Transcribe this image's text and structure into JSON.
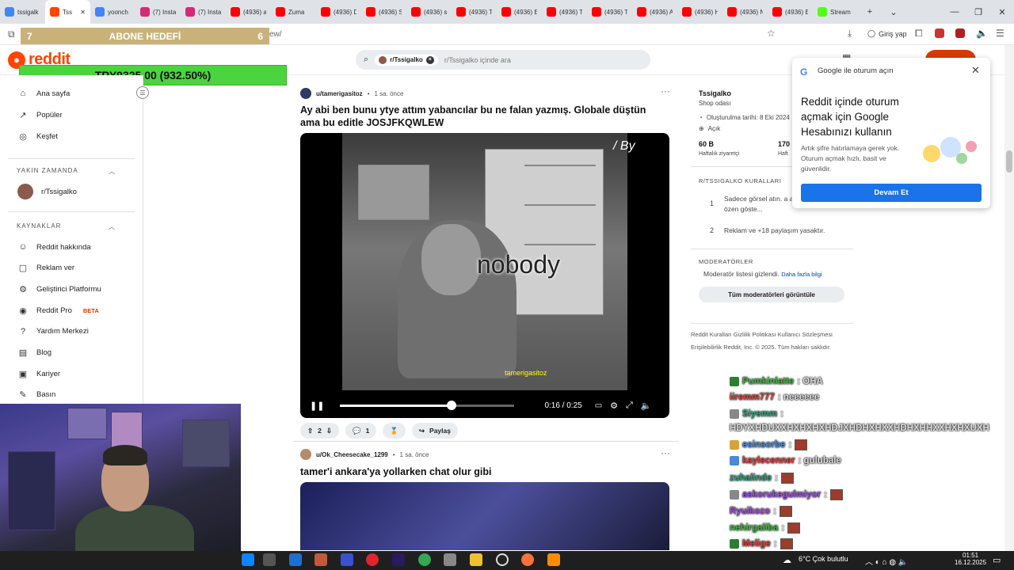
{
  "browser": {
    "tabs": [
      {
        "label": "tssigalk",
        "color": "#4285f4"
      },
      {
        "label": "Tss",
        "color": "#ff4500",
        "active": true
      },
      {
        "label": "yoonch",
        "color": "#4285f4"
      },
      {
        "label": "(7) Insta",
        "color": "#d62976"
      },
      {
        "label": "(7) Insta",
        "color": "#d62976"
      },
      {
        "label": "(4936) a",
        "color": "#ff0000"
      },
      {
        "label": "Zuma",
        "color": "#ff0000"
      },
      {
        "label": "(4936) D",
        "color": "#ff0000"
      },
      {
        "label": "(4936) S",
        "color": "#ff0000"
      },
      {
        "label": "(4936) s",
        "color": "#ff0000"
      },
      {
        "label": "(4936) T",
        "color": "#ff0000"
      },
      {
        "label": "(4936) E",
        "color": "#ff0000"
      },
      {
        "label": "(4936) T",
        "color": "#ff0000"
      },
      {
        "label": "(4936) T",
        "color": "#ff0000"
      },
      {
        "label": "(4936) A",
        "color": "#ff0000"
      },
      {
        "label": "(4936) H",
        "color": "#ff0000"
      },
      {
        "label": "(4936) N",
        "color": "#ff0000"
      },
      {
        "label": "(4936) E",
        "color": "#ff0000"
      },
      {
        "label": "Stream",
        "color": "#53fc18"
      }
    ],
    "url_fragment": "ew/",
    "login_label": "Giriş yap"
  },
  "overlay": {
    "abone_left": "7",
    "abone_label": "ABONE HEDEFİ",
    "abone_right": "6",
    "donation": "TRY9325.00 (932.50%)"
  },
  "reddit": {
    "logo": "reddit",
    "search_chip": "r/Tssigalko",
    "search_placeholder": "r/Tssigalko içinde ara"
  },
  "sidebar": {
    "nav": [
      {
        "label": "Ana sayfa",
        "icon": "⌂"
      },
      {
        "label": "Popüler",
        "icon": "↗"
      },
      {
        "label": "Keşfet",
        "icon": "◎"
      }
    ],
    "recent_header": "YAKIN ZAMANDA",
    "recent": [
      {
        "label": "r/Tssigalko"
      }
    ],
    "resources_header": "KAYNAKLAR",
    "resources": [
      {
        "label": "Reddit hakkında",
        "icon": "☺"
      },
      {
        "label": "Reklam ver",
        "icon": "▢"
      },
      {
        "label": "Geliştirici Platformu",
        "icon": "⚙"
      },
      {
        "label": "Reddit Pro",
        "icon": "◉",
        "badge": "BETA"
      },
      {
        "label": "Yardım Merkezi",
        "icon": "?"
      },
      {
        "label": "Blog",
        "icon": "▤"
      },
      {
        "label": "Kariyer",
        "icon": "▣"
      },
      {
        "label": "Basın",
        "icon": "✎"
      }
    ]
  },
  "post1": {
    "author": "u/tamerigasitoz",
    "time": "1 sa. önce",
    "title": "Ay abi ben bunu ytye attım yabancılar bu ne falan yazmış. Globale düştün ama bu editle JOSJFKQWLEW",
    "video_caption": "nobody",
    "video_watermark": "tamerigasitoz",
    "video_corner": "/ By",
    "time_display": "0:16 / 0:25",
    "progress": 0.64,
    "votes": "2",
    "comments": "1",
    "share": "Paylaş"
  },
  "post2": {
    "author": "u/Ok_Cheesecake_1299",
    "time": "1 sa. önce",
    "title": "tamer'i ankara'ya yollarken chat olur gibi"
  },
  "right": {
    "sub_name": "Tssigalko",
    "sub_desc": "Shop odası",
    "created": "Oluşturulma tarihi: 8 Eki 2024",
    "open": "Açık",
    "stat1_value": "60 B",
    "stat1_label": "Haftalık ziyaretçi",
    "stat2_value": "170",
    "stat2_label": "Haft",
    "rules_header": "R/TSSIGALKO KURALLARI",
    "rules": [
      {
        "num": "1",
        "text": "Sadece görsel atın. a atmamaya özen göste..."
      },
      {
        "num": "2",
        "text": "Reklam ve +18 paylaşım yasaktır."
      }
    ],
    "mods_header": "MODERATÖRLER",
    "mods_text": "Moderatör listesi gizlendi.",
    "mods_link": "Daha fazla bilgi",
    "mods_button": "Tüm moderatörleri görüntüle",
    "footer_line1": "Reddit Kuralları   Gizlilik Politikası   Kullanıcı Sözleşmesi",
    "footer_line2": "Erişilebilirlik   Reddit, Inc. © 2025. Tüm hakları saklıdır."
  },
  "google_popup": {
    "title": "Google ile oturum açın",
    "heading": "Reddit içinde oturum açmak için Google Hesabınızı kullanın",
    "body": "Artık şifre hatırlamaya gerek yok. Oturum açmak hızlı, basit ve güvenlidir.",
    "button": "Devam Et"
  },
  "chat": [
    {
      "user": "Pumkinlatte",
      "color": "#3ab53a",
      "msg": ": OHA",
      "badge": "#2e7d32"
    },
    {
      "user": "iiremm777",
      "color": "#e03a3a",
      "msg": ": neeeeee"
    },
    {
      "user": "Siyemm",
      "color": "#2aa07a",
      "msg": ":",
      "badge": "#888"
    },
    {
      "user": "",
      "color": "#ddd",
      "msg": "HDYXHDUXXHXHXHXHDJXHDHXHXXHDHXHHXXHXHXUXH"
    },
    {
      "user": "esinsorbe",
      "color": "#4a8ad8",
      "msg": ":",
      "badge": "#d8a23a",
      "emote": true
    },
    {
      "user": "kaylecenner",
      "color": "#e03a3a",
      "msg": ": gulubale",
      "badge": "#4a8ad8"
    },
    {
      "user": "zuhalinde",
      "color": "#2aa07a",
      "msg": ":",
      "emote": true
    },
    {
      "user": "askorukegulmiyor",
      "color": "#9a4ad8",
      "msg": ":",
      "badge": "#888",
      "emote": true
    },
    {
      "user": "Ryuikozo",
      "color": "#9a4ad8",
      "msg": ":",
      "emote": true
    },
    {
      "user": "nehirgaliba",
      "color": "#3ab53a",
      "msg": ":",
      "emote": true
    },
    {
      "user": "Melige",
      "color": "#e03a3a",
      "msg": ":",
      "badge": "#2e7d32",
      "emote": true
    }
  ],
  "taskbar": {
    "weather": "6°C  Çok bulutlu",
    "time": "01:51",
    "date": "16.12.2025"
  }
}
